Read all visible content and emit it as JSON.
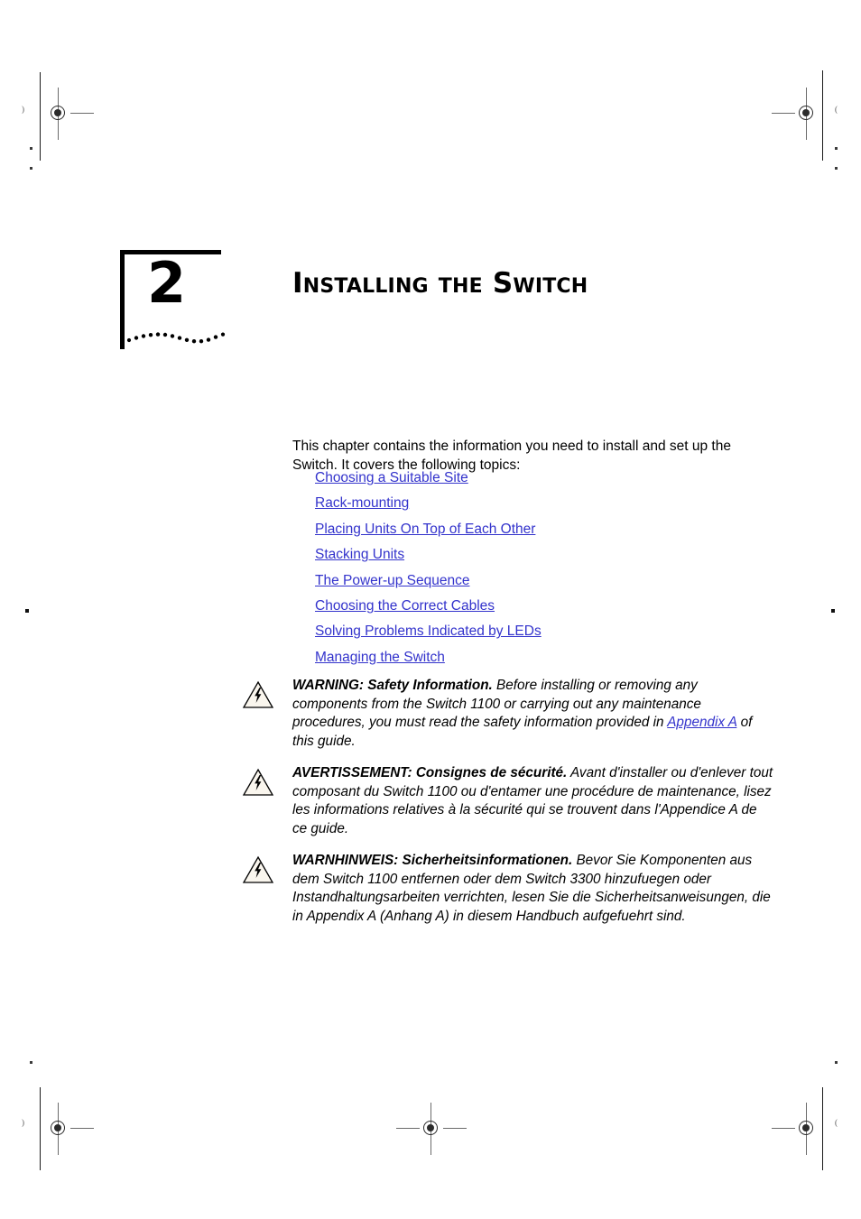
{
  "chapter": {
    "number": "2",
    "title": "Installing the Switch"
  },
  "intro": {
    "paragraph": "This chapter contains the information you need to install and set up the Switch. It covers the following topics:"
  },
  "topics": [
    {
      "label": "Choosing a Suitable Site"
    },
    {
      "label": "Rack-mounting"
    },
    {
      "label": "Placing Units On Top of Each Other"
    },
    {
      "label": "Stacking Units"
    },
    {
      "label": "The Power-up Sequence"
    },
    {
      "label": "Choosing the Correct Cables"
    },
    {
      "label": "Solving Problems Indicated by LEDs"
    },
    {
      "label": "Managing the Switch"
    }
  ],
  "notes": [
    {
      "icon": "warning-electrical-hazard-icon",
      "lead": "WARNING: Safety Information.",
      "text_before_link": " Before installing or removing any components from the Switch 1100 or carrying out any maintenance procedures, you must read the safety information provided in ",
      "link": "Appendix A",
      "text_after_link": " of this guide."
    },
    {
      "icon": "warning-electrical-hazard-icon",
      "lead": "AVERTISSEMENT: Consignes de sécurité.",
      "text": " Avant d'installer ou d'enlever tout composant du Switch 1100 ou d'entamer une procédure de maintenance, lisez les informations relatives à la sécurité qui se trouvent dans l'Appendice A de ce guide."
    },
    {
      "icon": "warning-electrical-hazard-icon",
      "lead": "WARNHINWEIS: Sicherheitsinformationen.",
      "text": " Bevor Sie Komponenten aus dem Switch 1100 entfernen oder dem Switch 3300 hinzufuegen oder Instandhaltungsarbeiten verrichten, lesen Sie die Sicherheitsanweisungen, die in Appendix A (Anhang A) in diesem Handbuch aufgefuehrt sind."
    }
  ],
  "colors": {
    "link": "#3333CC",
    "text": "#000000",
    "page_background": "#FFFFFF",
    "note_icon_fill": "#FAF6EE"
  }
}
